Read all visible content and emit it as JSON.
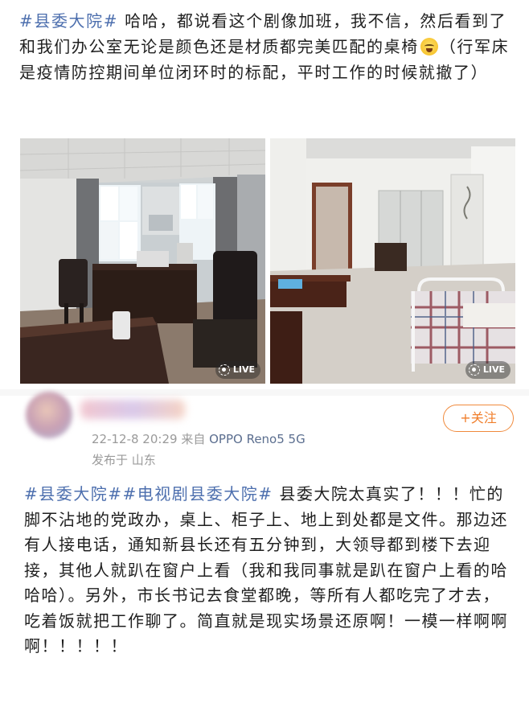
{
  "post1": {
    "hashtag": "#县委大院#",
    "text_a": " 哈哈，都说看这个剧像加班，我不信，然后看到了和我们办公室无论是颜色还是材质都完美匹配的桌椅",
    "emoji_name": "laughing-crying-emoji",
    "text_b": "（行军床是疫情防控期间单位闭环时的标配，平时工作的时候就撤了）"
  },
  "photos": [
    {
      "name": "office-photo-left",
      "badge": "LIVE"
    },
    {
      "name": "office-photo-right",
      "badge": "LIVE"
    }
  ],
  "comment": {
    "timestamp": "22-12-8 20:29",
    "source_prefix": " 来自 ",
    "source": "OPPO Reno5 5G",
    "location": "发布于 山东",
    "follow_label": "+关注"
  },
  "post2": {
    "hashtag1": "#县委大院#",
    "hashtag2": "#电视剧县委大院#",
    "text": " 县委大院太真实了！！！忙的脚不沾地的党政办，桌上、柜子上、地上到处都是文件。那边还有人接电话，通知新县长还有五分钟到，大领导都到楼下去迎接，其他人就趴在窗户上看（我和我同事就是趴在窗户上看的哈哈哈）。另外，市长书记去食堂都晚，等所有人都吃完了才去，吃着饭就把工作聊了。简直就是现实场景还原啊！一模一样啊啊啊！！！！！"
  },
  "colors": {
    "link": "#4d6fae",
    "follow": "#f07e2b",
    "meta": "#9a9a9a"
  }
}
